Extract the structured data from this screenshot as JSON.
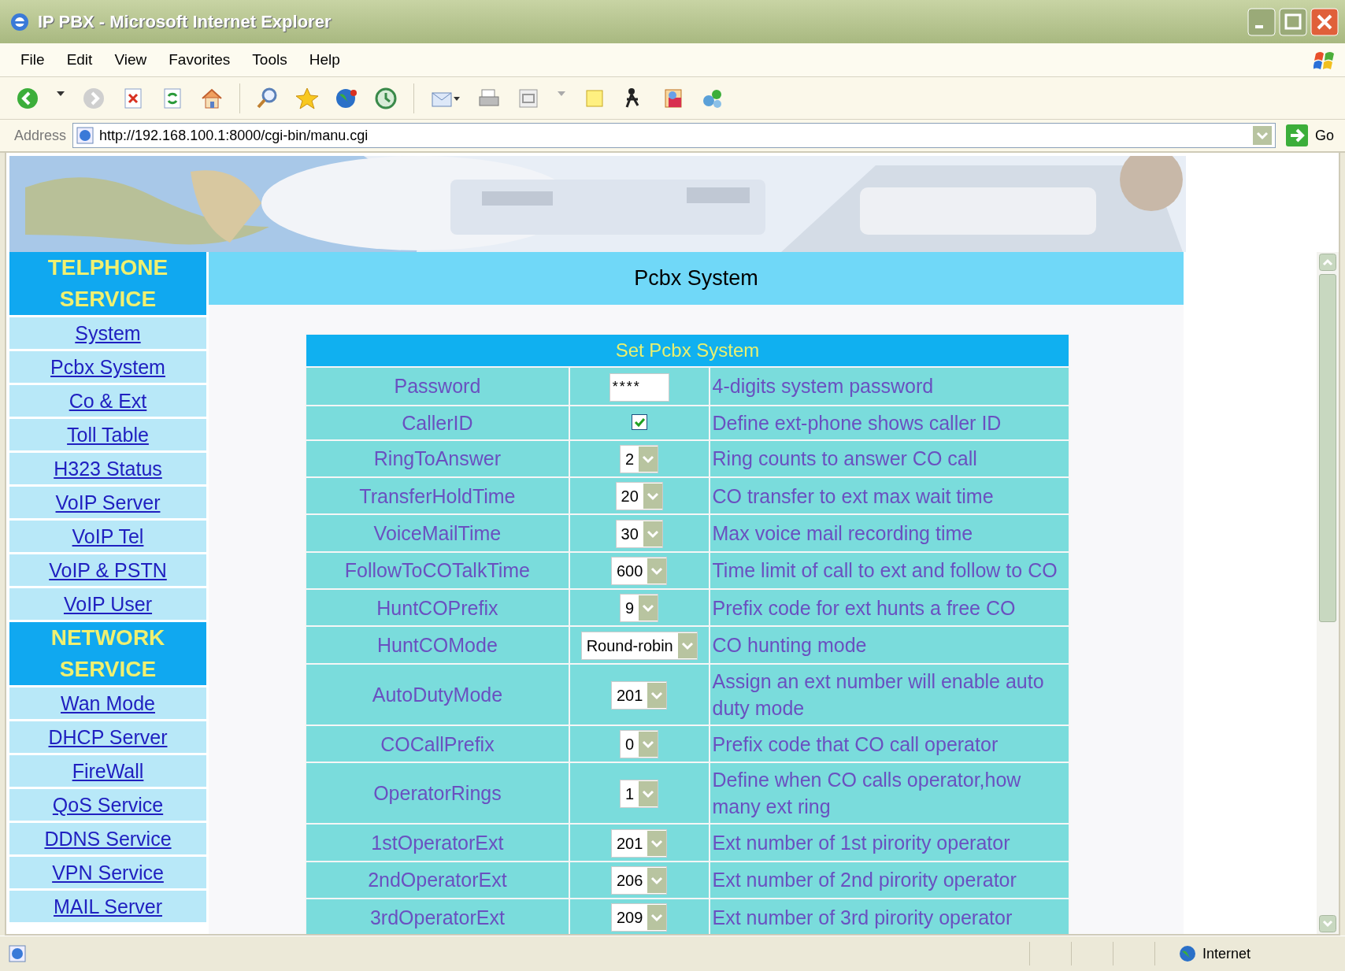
{
  "window": {
    "title": "IP PBX - Microsoft Internet Explorer"
  },
  "menu": [
    "File",
    "Edit",
    "View",
    "Favorites",
    "Tools",
    "Help"
  ],
  "address": {
    "label": "Address",
    "url": "http://192.168.100.1:8000/cgi-bin/manu.cgi",
    "go": "Go"
  },
  "sidebar": {
    "sections": [
      {
        "title": "TELPHONE SERVICE",
        "items": [
          "System",
          "Pcbx System",
          "Co & Ext",
          "Toll Table",
          "H323 Status",
          "VoIP Server",
          "VoIP Tel",
          "VoIP & PSTN",
          "VoIP User"
        ]
      },
      {
        "title": "NETWORK SERVICE",
        "items": [
          "Wan Mode",
          "DHCP Server",
          "FireWall",
          "QoS Service",
          "DDNS Service",
          "VPN Service",
          "MAIL Server"
        ]
      }
    ]
  },
  "main": {
    "title": "Pcbx System"
  },
  "form": {
    "title": "Set Pcbx System",
    "rows": [
      {
        "label": "Password",
        "kind": "password",
        "value": "****",
        "description": "4-digits system password"
      },
      {
        "label": "CallerID",
        "kind": "checkbox",
        "checked": true,
        "description": "Define ext-phone shows caller ID"
      },
      {
        "label": "RingToAnswer",
        "kind": "select",
        "value": "2",
        "description": "Ring counts to answer CO call"
      },
      {
        "label": "TransferHoldTime",
        "kind": "select",
        "value": "20",
        "description": "CO transfer to ext max wait time"
      },
      {
        "label": "VoiceMailTime",
        "kind": "select",
        "value": "30",
        "description": "Max voice mail recording time"
      },
      {
        "label": "FollowToCOTalkTime",
        "kind": "select",
        "value": "600",
        "description": "Time limit of call to ext and follow to CO"
      },
      {
        "label": "HuntCOPrefix",
        "kind": "select",
        "value": "9",
        "description": "Prefix code for ext hunts a free CO"
      },
      {
        "label": "HuntCOMode",
        "kind": "select",
        "value": "Round-robin",
        "description": "CO hunting mode"
      },
      {
        "label": "AutoDutyMode",
        "kind": "select",
        "value": "201",
        "description": "Assign an ext number will enable auto duty mode"
      },
      {
        "label": "COCallPrefix",
        "kind": "select",
        "value": "0",
        "description": "Prefix code that CO call operator"
      },
      {
        "label": "OperatorRings",
        "kind": "select",
        "value": "1",
        "description": "Define when CO calls operator,how many ext ring"
      },
      {
        "label": "1stOperatorExt",
        "kind": "select",
        "value": "201",
        "description": "Ext number of 1st pirority operator"
      },
      {
        "label": "2ndOperatorExt",
        "kind": "select",
        "value": "206",
        "description": "Ext number of 2nd pirority operator"
      },
      {
        "label": "3rdOperatorExt",
        "kind": "select",
        "value": "209",
        "description": "Ext number of 3rd pirority operator"
      }
    ]
  },
  "status_bar": {
    "zone": "Internet"
  }
}
